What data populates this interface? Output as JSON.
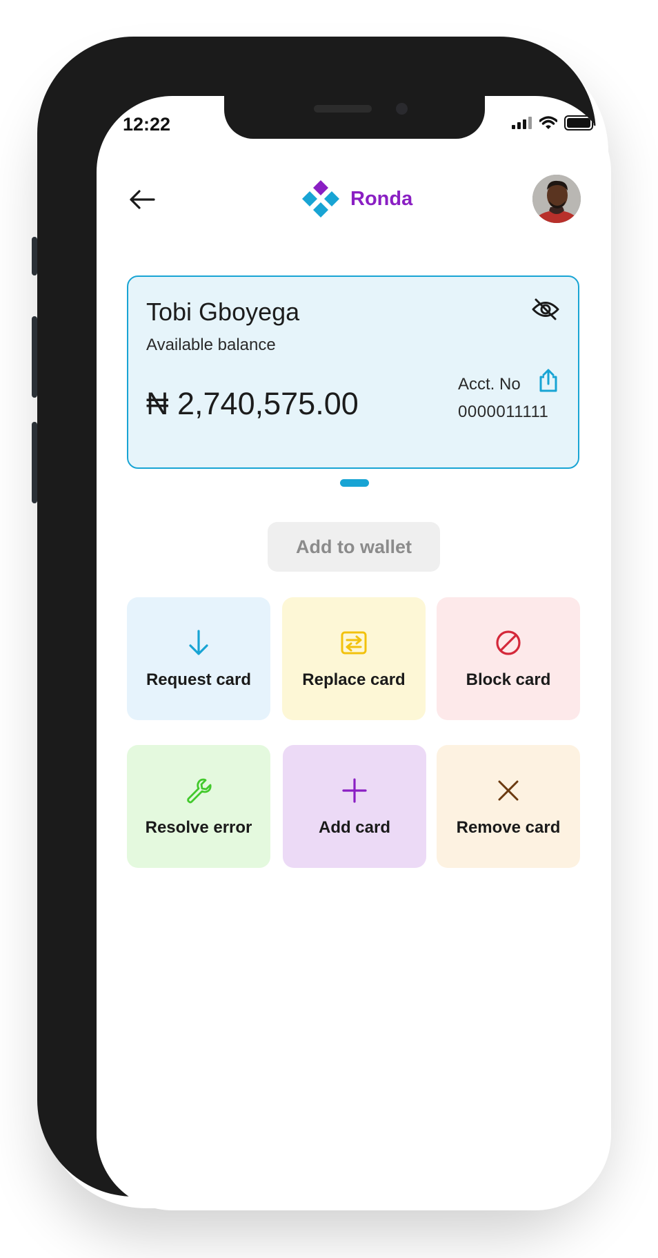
{
  "status_bar": {
    "time": "12:22"
  },
  "header": {
    "brand_name": "Ronda",
    "logo_colors": [
      "#8a1fc3",
      "#18a4d4",
      "#18a4d4",
      "#18a4d4"
    ]
  },
  "account_card": {
    "holder_name": "Tobi Gboyega",
    "balance_label": "Available balance",
    "balance_amount": "₦ 2,740,575.00",
    "account_label": "Acct. No",
    "account_number": "0000011111",
    "accent_color": "#18a4d4"
  },
  "wallet_button": {
    "label": "Add to wallet"
  },
  "actions": [
    {
      "label": "Request card",
      "icon": "arrow-down-icon",
      "bg": "#e6f3fc",
      "color": "#18a4d4"
    },
    {
      "label": "Replace card",
      "icon": "swap-icon",
      "bg": "#fdf7d6",
      "color": "#f2c20d"
    },
    {
      "label": "Block card",
      "icon": "block-icon",
      "bg": "#fde9ea",
      "color": "#d4283a"
    },
    {
      "label": "Resolve error",
      "icon": "wrench-icon",
      "bg": "#e4f9de",
      "color": "#42c92c"
    },
    {
      "label": "Add card",
      "icon": "plus-icon",
      "bg": "#ecdaf6",
      "color": "#8a1fc3"
    },
    {
      "label": "Remove card",
      "icon": "close-icon",
      "bg": "#fdf2e1",
      "color": "#6b3a10"
    }
  ]
}
